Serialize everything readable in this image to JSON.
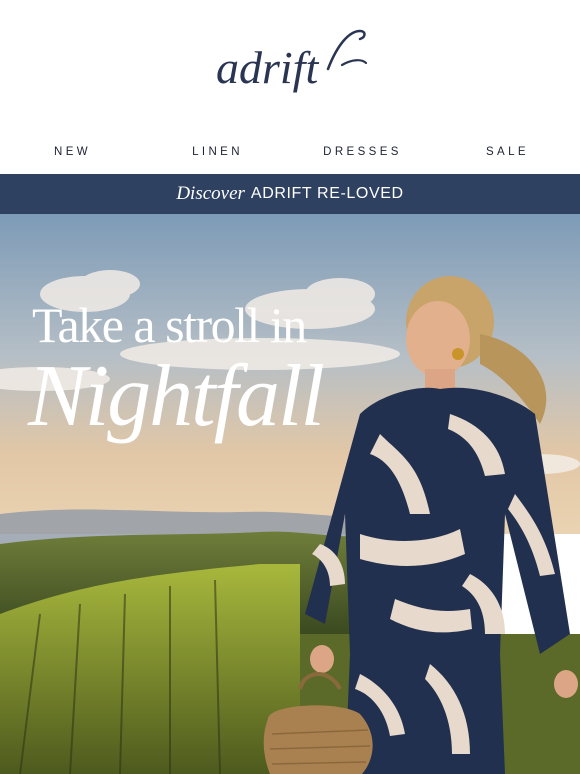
{
  "brand": {
    "logo_text": "adrift"
  },
  "nav": {
    "items": [
      {
        "label": "NEW"
      },
      {
        "label": "LINEN"
      },
      {
        "label": "DRESSES"
      },
      {
        "label": "SALE"
      }
    ]
  },
  "banner": {
    "discover": "Discover",
    "name": "ADRIFT RE-LOVED"
  },
  "hero": {
    "line1": "Take a stroll in",
    "line2": "Nightfall"
  },
  "colors": {
    "navy": "#2f4161",
    "logo": "#2a3553",
    "text": "#1c2233"
  }
}
